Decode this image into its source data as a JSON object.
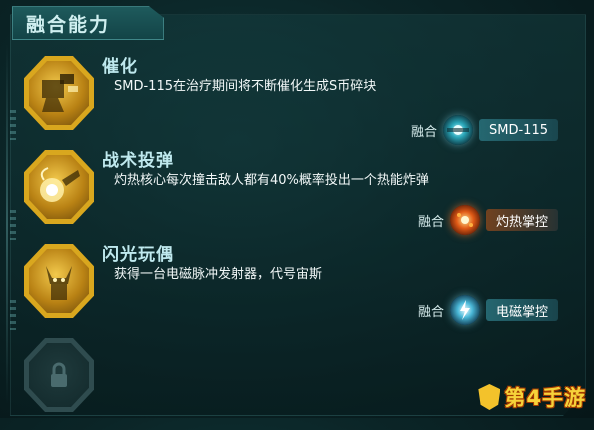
{
  "panel": {
    "title": "融合能力"
  },
  "abilities": [
    {
      "name": "催化",
      "description": "SMD-115在治疗期间将不断催化生成S币碎块",
      "fusion_label": "融合",
      "fusion_target": "SMD-115",
      "fusion_icon": "drone-icon",
      "badge_icon": "robot-arm-icon"
    },
    {
      "name": "战术投弹",
      "description": "灼热核心每次撞击敌人都有40%概率投出一个热能炸弹",
      "fusion_label": "融合",
      "fusion_target": "灼热掌控",
      "fusion_icon": "fire-orb-icon",
      "badge_icon": "bomb-throw-icon"
    },
    {
      "name": "闪光玩偶",
      "description": "获得一台电磁脉冲发射器，代号宙斯",
      "fusion_label": "融合",
      "fusion_target": "电磁掌控",
      "fusion_icon": "lightning-orb-icon",
      "badge_icon": "doll-icon"
    }
  ],
  "locked_slot": {
    "icon": "lock-icon"
  },
  "watermark": {
    "text": "第4手游"
  },
  "colors": {
    "accent_gold": "#d9a71e",
    "title_cyan": "#bfe9ee",
    "panel_bg": "#0b2527"
  }
}
